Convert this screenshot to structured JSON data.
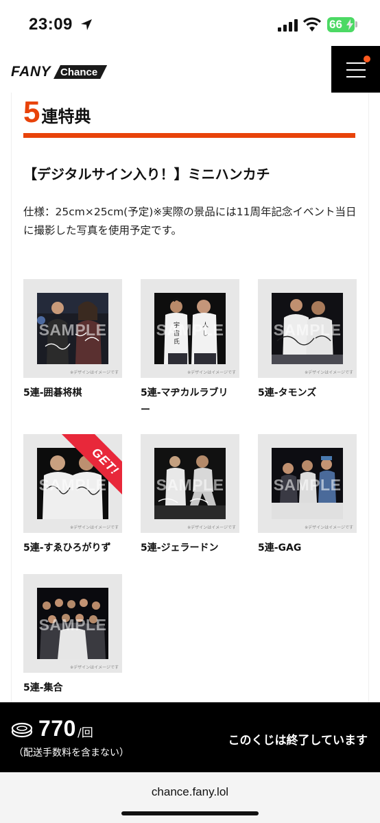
{
  "status_bar": {
    "time": "23:09",
    "battery": "66"
  },
  "header": {
    "logo_fany": "FANY",
    "logo_chance": "Chance"
  },
  "section": {
    "number": "5",
    "title": "連特典"
  },
  "prize": {
    "title": "【デジタルサイン入り！】ミニハンカチ",
    "description": "仕様：25cm×25cm(予定)※実際の景品には11周年記念イベント当日に撮影した写真を使用予定です。"
  },
  "thumbnail_overlay": {
    "sample": "SAMPLE",
    "note": "※デザインはイメージです"
  },
  "items": [
    {
      "label": "5連-囲碁将棋",
      "got": false
    },
    {
      "label": "5連-マヂカルラブリー",
      "got": false
    },
    {
      "label": "5連-タモンズ",
      "got": false
    },
    {
      "label": "5連-すゑひろがりず",
      "got": true,
      "badge": "GET!"
    },
    {
      "label": "5連-ジェラードン",
      "got": false
    },
    {
      "label": "5連-GAG",
      "got": false
    },
    {
      "label": "5連-集合",
      "got": false
    }
  ],
  "purchase_bar": {
    "price": "770",
    "unit": "/回",
    "shipping_note": "（配送手数料を含まない）",
    "status": "このくじは終了しています"
  },
  "browser": {
    "url": "chance.fany.lol"
  },
  "colors": {
    "accent": "#e8430a",
    "get_badge": "#e8283a",
    "bar": "#000000"
  }
}
